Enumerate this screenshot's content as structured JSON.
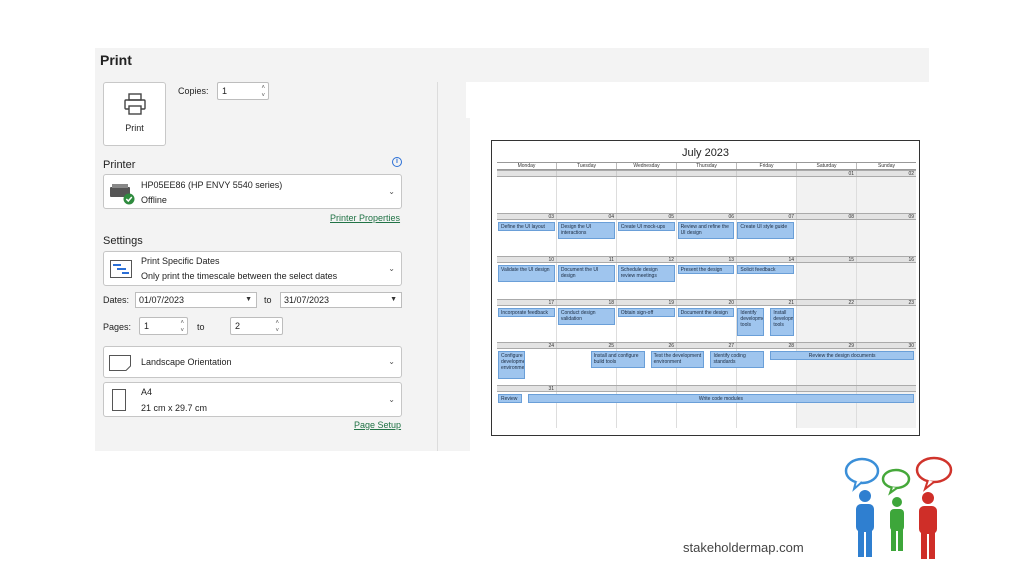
{
  "header": {
    "title": "Print"
  },
  "print_button": {
    "label": "Print",
    "icon": "printer-icon"
  },
  "copies": {
    "label": "Copies:",
    "value": "1"
  },
  "printer": {
    "section_label": "Printer",
    "name": "HP05EE86 (HP ENVY 5540 series)",
    "status": "Offline",
    "properties_link": "Printer Properties"
  },
  "settings": {
    "section_label": "Settings",
    "timescale": {
      "line1": "Print Specific Dates",
      "line2": "Only print the timescale between the select dates"
    },
    "dates": {
      "label": "Dates:",
      "from": "01/07/2023",
      "to_label": "to",
      "to": "31/07/2023"
    },
    "pages": {
      "label": "Pages:",
      "from": "1",
      "to_label": "to",
      "to": "2"
    },
    "orientation": {
      "label": "Landscape Orientation"
    },
    "paper": {
      "line1": "A4",
      "line2": "21 cm x 29.7 cm"
    },
    "page_setup_link": "Page Setup"
  },
  "preview": {
    "month_title": "July 2023",
    "days": [
      "Monday",
      "Tuesday",
      "Wednesday",
      "Thursday",
      "Friday",
      "Saturday",
      "Sunday"
    ],
    "weeks": [
      {
        "nums": [
          "",
          "",
          "",
          "",
          "",
          "01",
          "02"
        ]
      },
      {
        "nums": [
          "03",
          "04",
          "05",
          "06",
          "07",
          "08",
          "09"
        ]
      },
      {
        "nums": [
          "10",
          "11",
          "12",
          "13",
          "14",
          "15",
          "16"
        ]
      },
      {
        "nums": [
          "17",
          "18",
          "19",
          "20",
          "21",
          "22",
          "23"
        ]
      },
      {
        "nums": [
          "24",
          "25",
          "26",
          "27",
          "28",
          "29",
          "30"
        ]
      },
      {
        "nums": [
          "31",
          "",
          "",
          "",
          "",
          "",
          ""
        ]
      }
    ],
    "events": [
      {
        "text": "Define the UI layout",
        "week": 1,
        "day": 0,
        "span": 1
      },
      {
        "text": "Design the UI interactions",
        "week": 1,
        "day": 1,
        "span": 1
      },
      {
        "text": "Create UI mock-ups",
        "week": 1,
        "day": 2,
        "span": 1
      },
      {
        "text": "Review and refine the UI design",
        "week": 1,
        "day": 3,
        "span": 1
      },
      {
        "text": "Create UI style guide",
        "week": 1,
        "day": 4,
        "span": 1
      },
      {
        "text": "Validate the UI design",
        "week": 2,
        "day": 0,
        "span": 1
      },
      {
        "text": "Document the UI design",
        "week": 2,
        "day": 1,
        "span": 1
      },
      {
        "text": "Schedule design review meetings",
        "week": 2,
        "day": 2,
        "span": 1
      },
      {
        "text": "Present the design",
        "week": 2,
        "day": 3,
        "span": 1
      },
      {
        "text": "Solicit feedback",
        "week": 2,
        "day": 4,
        "span": 1
      },
      {
        "text": "Incorporate feedback",
        "week": 3,
        "day": 0,
        "span": 1
      },
      {
        "text": "Conduct design validation",
        "week": 3,
        "day": 1,
        "span": 1
      },
      {
        "text": "Obtain sign-off",
        "week": 3,
        "day": 2,
        "span": 1
      },
      {
        "text": "Document the design",
        "week": 3,
        "day": 3,
        "span": 1
      },
      {
        "text": "Identify development tools",
        "week": 3,
        "day": 4,
        "span": 0.5
      },
      {
        "text": "Install development tools",
        "week": 3,
        "day": 4.55,
        "span": 0.45
      },
      {
        "text": "Configure development environment",
        "week": 4,
        "day": 0,
        "span": 0.5
      },
      {
        "text": "Install and configure build tools",
        "week": 4,
        "day": 1.55,
        "span": 0.95
      },
      {
        "text": "Test the development environment",
        "week": 4,
        "day": 2.55,
        "span": 0.95
      },
      {
        "text": "Identify coding standards",
        "week": 4,
        "day": 3.55,
        "span": 0.95
      },
      {
        "text": "Review the design documents",
        "week": 4,
        "day": 4.55,
        "span": 2.45
      },
      {
        "text": "Review the",
        "week": 5,
        "day": 0,
        "span": 0.45
      },
      {
        "text": "Write code modules",
        "week": 5,
        "day": 0.5,
        "span": 6.5
      }
    ]
  },
  "footer": {
    "brand": "stakeholdermap.com"
  }
}
